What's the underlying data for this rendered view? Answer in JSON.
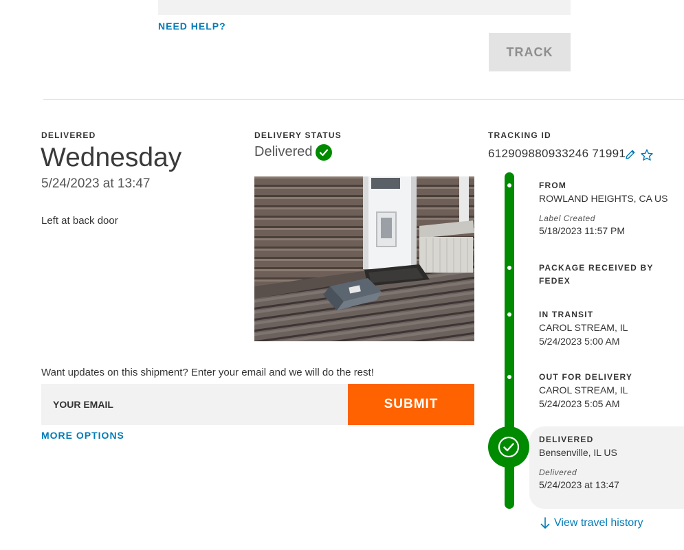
{
  "search": {
    "need_help": "NEED HELP?",
    "track_label": "TRACK"
  },
  "summary": {
    "delivered_label": "DELIVERED",
    "weekday": "Wednesday",
    "datetime": "5/24/2023 at 13:47",
    "delivery_note": "Left at back door"
  },
  "status": {
    "label": "DELIVERY STATUS",
    "value": "Delivered"
  },
  "updates": {
    "prompt": "Want updates on this shipment? Enter your email and we will do the rest!",
    "email_placeholder": "YOUR EMAIL",
    "submit_label": "SUBMIT",
    "more_options": "MORE OPTIONS"
  },
  "tracking": {
    "label": "TRACKING ID",
    "id": "612909880933246 71991",
    "events": [
      {
        "title": "FROM",
        "location": "ROWLAND HEIGHTS, CA US",
        "status": "Label Created",
        "time": "5/18/2023 11:57 PM"
      },
      {
        "title": "PACKAGE RECEIVED BY",
        "title2": "FEDEX"
      },
      {
        "title": "IN TRANSIT",
        "location": "CAROL STREAM, IL",
        "time": "5/24/2023 5:00 AM"
      },
      {
        "title": "OUT FOR DELIVERY",
        "location": "CAROL STREAM, IL",
        "time": "5/24/2023 5:05 AM"
      },
      {
        "title": "DELIVERED",
        "location": "Bensenville, IL US",
        "status": "Delivered",
        "time": "5/24/2023 at 13:47"
      }
    ],
    "travel_history": "View travel history"
  },
  "colors": {
    "accent_link": "#007ab7",
    "success_green": "#008a00",
    "submit_orange": "#ff6200"
  }
}
